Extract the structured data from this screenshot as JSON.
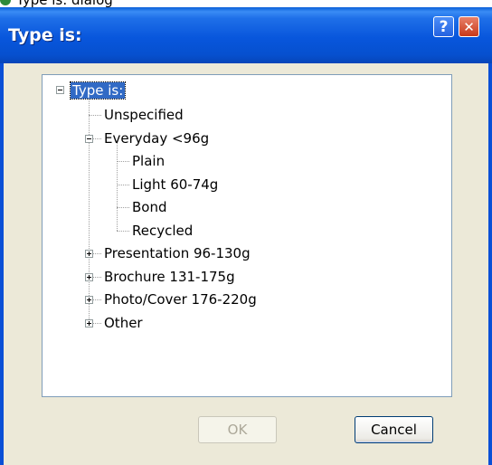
{
  "background_window": {
    "title_fragment": "Type is: dialog"
  },
  "dialog": {
    "title": "Type is:",
    "help_glyph": "?",
    "close_glyph": "✕"
  },
  "tree": {
    "root": "Type is:",
    "items": [
      "Unspecified",
      "Everyday <96g",
      "Plain",
      "Light 60-74g",
      "Bond",
      "Recycled",
      "Presentation 96-130g",
      "Brochure 131-175g",
      "Photo/Cover 176-220g",
      "Other"
    ]
  },
  "buttons": {
    "ok": "OK",
    "cancel": "Cancel"
  },
  "colors": {
    "titlebar": "#0856dc",
    "selection": "#316ac5",
    "dialog_bg": "#ece9d8"
  },
  "icons": [
    "help-icon",
    "close-icon",
    "collapse-icon",
    "expand-icon"
  ]
}
